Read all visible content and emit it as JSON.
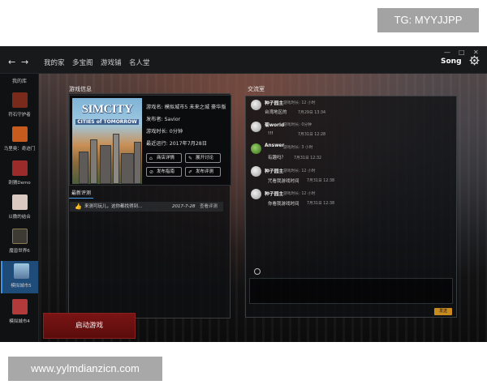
{
  "watermarks": {
    "top": "TG: MYYJJPP",
    "bottom": "www.yylmdianzicn.com"
  },
  "titlebar": {
    "nav": [
      "我的家",
      "多宝阁",
      "游戏铺",
      "名人堂"
    ],
    "user": "Song",
    "window_controls": {
      "minimize": "—",
      "maximize": "□",
      "close": "✕"
    },
    "back_icon": "←",
    "forward_icon": "→"
  },
  "sidebar": {
    "header": "我的库",
    "items": [
      {
        "label": "符石守护者",
        "color": "#7a2a1a"
      },
      {
        "label": "马里奥：奇迹门",
        "color": "#c75b1e"
      },
      {
        "label": "刺猬Demo",
        "color": "#9b2a2a"
      },
      {
        "label": "以撒的结合",
        "color": "#d9c9c0"
      },
      {
        "label": "魔兽世界6",
        "color": "#3d3a34"
      },
      {
        "label": "模拟城市5",
        "color": "#5a7aa0"
      },
      {
        "label": "模拟城市4",
        "color": "#b33a3a"
      }
    ],
    "active_index": 5
  },
  "game_info": {
    "section_title": "游戏信息",
    "cover_title": "SIMCITY",
    "cover_subtitle": "CITIES of TOMORROW",
    "name_line": "游戏名: 模拟城市5 未来之城 豪华版",
    "publisher_line": "发布者: Savior",
    "playtime_line": "游戏时长: 0分钟",
    "last_run_line": "最近运行: 2017年7月28日",
    "buttons": [
      {
        "label": "商店详情",
        "icon": "⌂"
      },
      {
        "label": "展开讨论",
        "icon": "✎"
      },
      {
        "label": "发布指南",
        "icon": "⊘"
      },
      {
        "label": "发布评测",
        "icon": "✐"
      }
    ]
  },
  "reviews": {
    "tab": "最新评测",
    "items": [
      {
        "text": "来测可玩儿，这你都找得到...",
        "date": "2017-7-28",
        "action": "查看评测"
      }
    ]
  },
  "chat": {
    "title": "交流室",
    "messages": [
      {
        "name": "种子园主",
        "meta": "游戏时长: 12 小时",
        "text": "台湾地区的",
        "time": "7月29日 13:34"
      },
      {
        "name": "菊world",
        "meta": "游戏时长: 0分钟",
        "text": "!!!",
        "time": "7月31日 12:28"
      },
      {
        "name": "Answer",
        "meta": "游戏时长: 3 小时",
        "text": "有趣吗？",
        "time": "7月31日 12:32"
      },
      {
        "name": "种子园主",
        "meta": "游戏时长: 12 小时",
        "text": "咒看我游戏时间",
        "time": "7月31日 12:38"
      },
      {
        "name": "种子园主",
        "meta": "游戏时长: 12 小时",
        "text": "你看我游戏时间",
        "time": "7月31日 12:38"
      }
    ],
    "send_label": "发送"
  },
  "launch_button": "启动游戏"
}
